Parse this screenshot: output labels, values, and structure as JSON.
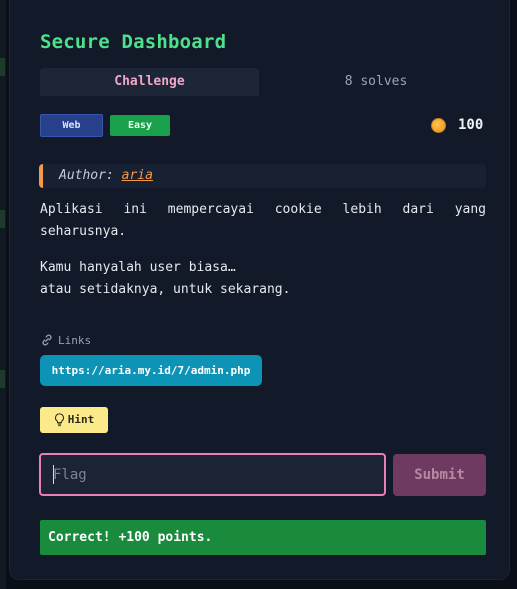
{
  "challenge": {
    "title": "Secure Dashboard",
    "tabs": {
      "active_label": "Challenge",
      "solves_label": "8 solves"
    },
    "category": "Web",
    "difficulty": "Easy",
    "points": "100",
    "author_prefix": "Author:",
    "author_name": "aria",
    "description_line1_words": [
      "Aplikasi",
      "ini",
      "mempercayai",
      "cookie",
      "lebih",
      "dari",
      "yang"
    ],
    "description_line1_cont": "seharusnya.",
    "description_line2": "Kamu hanyalah user biasa…",
    "description_line3": "atau setidaknya, untuk sekarang.",
    "links_label": "Links",
    "link_url": "https://aria.my.id/7/admin.php",
    "hint_label": "Hint",
    "flag_placeholder": "Flag",
    "submit_label": "Submit",
    "result_message": "Correct! +100 points."
  },
  "icons": {
    "link": "link-icon",
    "hint": "lightbulb-icon",
    "points": "coin-icon"
  },
  "colors": {
    "title": "#4ee08a",
    "active_tab_text": "#f0a6c8",
    "category_badge": "#283f8a",
    "difficulty_badge": "#19a04a",
    "author_accent": "#f29a4a",
    "link_button": "#0d93b5",
    "hint_button": "#fce98a",
    "input_border": "#e97fb8",
    "submit_button": "#6f3a62",
    "success": "#1a8a3c"
  }
}
